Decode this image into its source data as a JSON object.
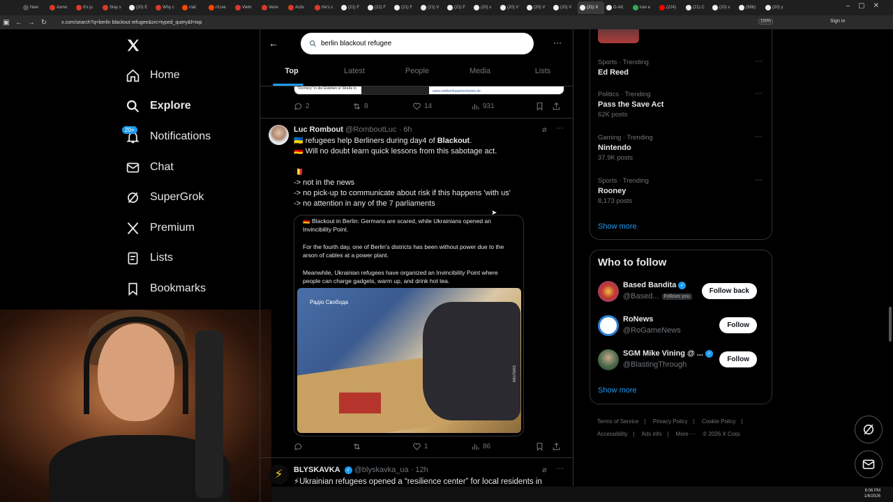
{
  "browser": {
    "tabs": [
      {
        "label": "New",
        "color": "#555"
      },
      {
        "label": "Asmo",
        "color": "#d9392b"
      },
      {
        "label": "It's ju",
        "color": "#d9392b"
      },
      {
        "label": "Stay s",
        "color": "#d9392b"
      },
      {
        "label": "(20) E",
        "color": "#eee"
      },
      {
        "label": "Why c",
        "color": "#d9392b"
      },
      {
        "label": "r/all",
        "color": "#ff4500"
      },
      {
        "label": "r/Live",
        "color": "#ff4500"
      },
      {
        "label": "Vietn",
        "color": "#d9392b"
      },
      {
        "label": "Vene",
        "color": "#d9392b"
      },
      {
        "label": "Activ",
        "color": "#d9392b"
      },
      {
        "label": "He's c",
        "color": "#d9392b"
      },
      {
        "label": "(21) F",
        "color": "#eee"
      },
      {
        "label": "(21) F",
        "color": "#eee"
      },
      {
        "label": "(21) F",
        "color": "#eee"
      },
      {
        "label": "(21) V",
        "color": "#eee"
      },
      {
        "label": "(21) F",
        "color": "#eee"
      },
      {
        "label": "(20) x",
        "color": "#eee"
      },
      {
        "label": "(20) V",
        "color": "#eee"
      },
      {
        "label": "(20) V",
        "color": "#eee"
      },
      {
        "label": "(20) V",
        "color": "#eee"
      },
      {
        "label": "(21) X",
        "color": "#eee",
        "active": true
      },
      {
        "label": "G-Att",
        "color": "#eee"
      },
      {
        "label": "iran e",
        "color": "#34a853"
      },
      {
        "label": "(224)",
        "color": "#ff0000"
      },
      {
        "label": "(21) C",
        "color": "#eee"
      },
      {
        "label": "(20) x",
        "color": "#eee"
      },
      {
        "label": "(99b)",
        "color": "#eee"
      },
      {
        "label": "(20) y",
        "color": "#eee"
      }
    ],
    "url": "x.com/search?q=berlin blackout refugee&src=typed_query&f=top",
    "zoom": "150%",
    "signin": "Sign in",
    "clock_time": "6:06 PM",
    "clock_date": "1/6/2026"
  },
  "sidebar": {
    "logo": "X",
    "items": [
      {
        "label": "Home",
        "icon": "home-icon"
      },
      {
        "label": "Explore",
        "icon": "search-icon"
      },
      {
        "label": "Notifications",
        "icon": "bell-icon"
      },
      {
        "label": "Chat",
        "icon": "mail-icon"
      },
      {
        "label": "SuperGrok",
        "icon": "grok-icon"
      },
      {
        "label": "Premium",
        "icon": "x-icon"
      },
      {
        "label": "Lists",
        "icon": "list-icon"
      },
      {
        "label": "Bookmarks",
        "icon": "bookmark-icon"
      }
    ],
    "notif_badge": "20+"
  },
  "search": {
    "query": "berlin blackout refugee"
  },
  "tabs": [
    "Top",
    "Latest",
    "People",
    "Media",
    "Lists"
  ],
  "prev_tweet": {
    "replies": "2",
    "reposts": "8",
    "likes": "14",
    "views": "931",
    "image_caption_left": "\"Dormery\" in der Eisleben er Straße in",
    "image_caption_right": "www.visitberlinpartnerhotels.de"
  },
  "tweet": {
    "name": "Luc Rombout",
    "handle": "@RomboutLuc",
    "time": "· 6h",
    "line1_flag": "🇺🇦",
    "line1_pre": " refugees help Berliners during day4 of ",
    "line1_bold": "Blackout",
    "line1_post": ".",
    "line2_flag": "🇩🇪",
    "line2": " Will no doubt learn quick lessons from this sabotage act.",
    "line3_flag": "🇧🇪",
    "line4": "-> not in the news",
    "line5": "-> no pick-up to communicate about risk if this happens 'with us'",
    "line6": "-> no attention in any of the 7 parliaments",
    "quote_p1": "🇩🇪 Blackout in Berlin: Germans are scared, while Ukrainians opened an Invincibility Point.",
    "quote_p2": "For the fourth day, one of Berlin's districts has been without power due to the arson of cables at a power plant.",
    "quote_p3": "Meanwhile, Ukrainian refugees have organized an Invincibility Point where people can charge gadgets, warm up, and drink hot tea.",
    "photo_logo": "Радіо Свобода",
    "photo_credit": "REUTERS",
    "replies": "",
    "reposts": "",
    "likes": "1",
    "views": "86"
  },
  "next_tweet": {
    "name": "BLYSKAVKA",
    "handle": "@blyskavka_ua",
    "time": "· 12h",
    "text": "⚡Ukrainian refugees opened a “resilience center” for local residents in"
  },
  "trends": [
    {
      "category": "Sports · Trending",
      "name": "Ed Reed",
      "posts": ""
    },
    {
      "category": "Politics · Trending",
      "name": "Pass the Save Act",
      "posts": "62K posts"
    },
    {
      "category": "Gaming · Trending",
      "name": "Nintendo",
      "posts": "37.9K posts"
    },
    {
      "category": "Sports · Trending",
      "name": "Rooney",
      "posts": "8,173 posts"
    }
  ],
  "trends_show_more": "Show more",
  "who_to_follow": {
    "title": "Who to follow",
    "accounts": [
      {
        "name": "Based Bandita",
        "handle": "@Based...",
        "follows_you": "Follows you",
        "button": "Follow back",
        "verified": true,
        "avatar_color": "#8b3fa8"
      },
      {
        "name": "RoNews",
        "handle": "@RoGameNews",
        "follows_you": "",
        "button": "Follow",
        "verified": false,
        "avatar_color": "#2a7fd4"
      },
      {
        "name": "SGM Mike Vining @ ...",
        "handle": "@BlastingThrough",
        "follows_you": "",
        "button": "Follow",
        "verified": true,
        "avatar_color": "#4a6a4a"
      }
    ],
    "show_more": "Show more"
  },
  "footer": {
    "links": [
      "Terms of Service",
      "|",
      "Privacy Policy",
      "|",
      "Cookie Policy",
      "|",
      "Accessibility",
      "|",
      "Ads info",
      "|",
      "More ···",
      "© 2026 X Corp."
    ]
  },
  "colors": {
    "accent": "#1d9bf0",
    "background": "#000000",
    "border": "#2f3336",
    "muted": "#71767b"
  }
}
